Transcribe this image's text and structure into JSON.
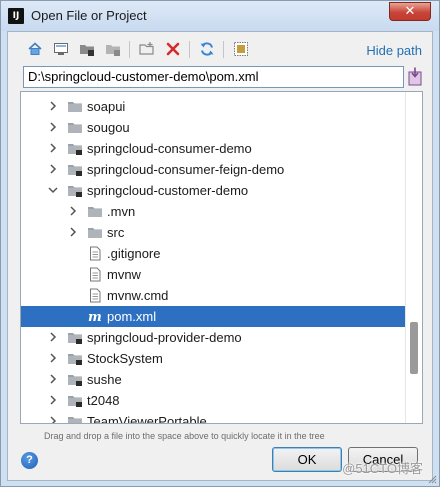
{
  "window": {
    "title": "Open File or Project",
    "close_glyph": "✕",
    "app_icon_text": "IJ"
  },
  "toolbar": {
    "icons": [
      "home-icon",
      "desktop-icon",
      "project-icon",
      "module-icon",
      "new-folder-icon",
      "delete-icon",
      "refresh-icon",
      "show-hidden-icon"
    ],
    "hide_path_label": "Hide path"
  },
  "path": {
    "value": "D:\\springcloud-customer-demo\\pom.xml"
  },
  "tree": {
    "items": [
      {
        "label": "soapui",
        "depth": 1,
        "expanded": false,
        "type": "folder"
      },
      {
        "label": "sougou",
        "depth": 1,
        "expanded": false,
        "type": "folder"
      },
      {
        "label": "springcloud-consumer-demo",
        "depth": 1,
        "expanded": false,
        "type": "module-folder"
      },
      {
        "label": "springcloud-consumer-feign-demo",
        "depth": 1,
        "expanded": false,
        "type": "module-folder"
      },
      {
        "label": "springcloud-customer-demo",
        "depth": 1,
        "expanded": true,
        "type": "module-folder"
      },
      {
        "label": ".mvn",
        "depth": 2,
        "expanded": false,
        "type": "folder"
      },
      {
        "label": "src",
        "depth": 2,
        "expanded": false,
        "type": "folder"
      },
      {
        "label": ".gitignore",
        "depth": 2,
        "type": "file"
      },
      {
        "label": "mvnw",
        "depth": 2,
        "type": "file"
      },
      {
        "label": "mvnw.cmd",
        "depth": 2,
        "type": "file"
      },
      {
        "label": "pom.xml",
        "depth": 2,
        "type": "maven",
        "selected": true
      },
      {
        "label": "springcloud-provider-demo",
        "depth": 1,
        "expanded": false,
        "type": "module-folder"
      },
      {
        "label": "StockSystem",
        "depth": 1,
        "expanded": false,
        "type": "module-folder"
      },
      {
        "label": "sushe",
        "depth": 1,
        "expanded": false,
        "type": "module-folder"
      },
      {
        "label": "t2048",
        "depth": 1,
        "expanded": false,
        "type": "module-folder"
      },
      {
        "label": "TeamViewerPortable",
        "depth": 1,
        "expanded": false,
        "type": "folder"
      }
    ]
  },
  "hint": "Drag and drop a file into the space above to quickly locate it in the tree",
  "buttons": {
    "help": "?",
    "ok": "OK",
    "cancel": "Cancel"
  },
  "watermark": "@51CTO博客",
  "colors": {
    "selection": "#2d6fc1",
    "link": "#2470b3",
    "delete": "#d62b2b",
    "refresh": "#3a86d6"
  }
}
